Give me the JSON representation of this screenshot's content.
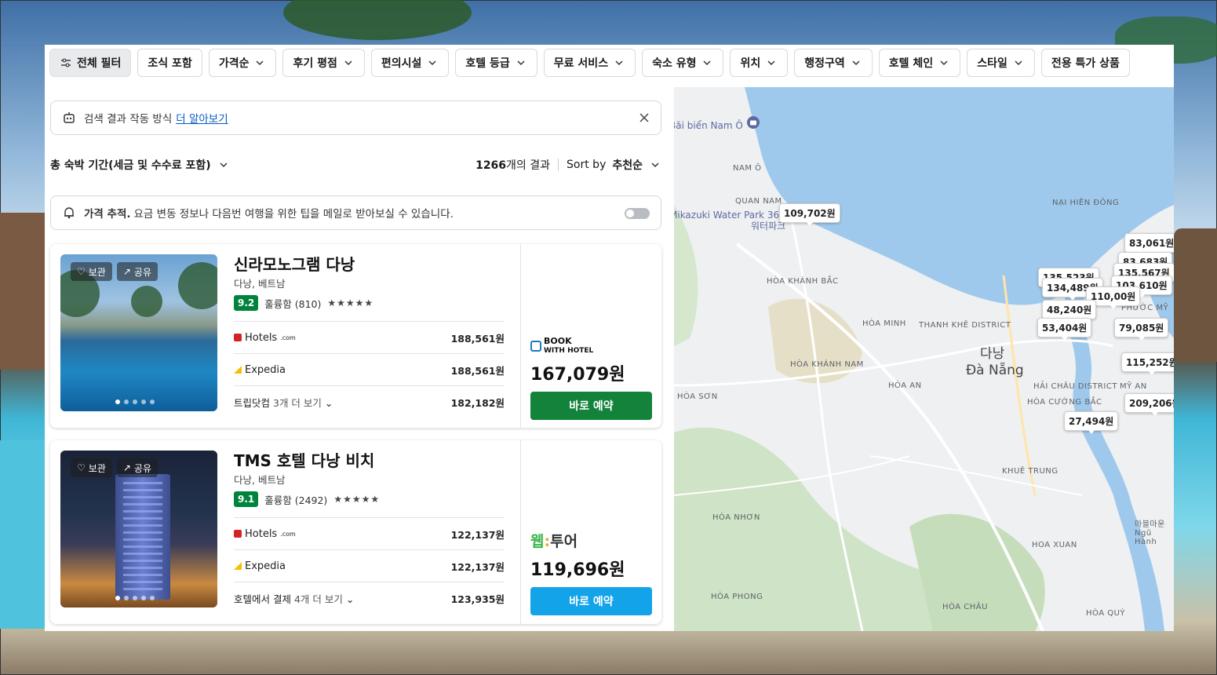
{
  "filters": [
    {
      "label": "전체 필터",
      "icon": "sliders-icon",
      "dropdown": false,
      "primary": true
    },
    {
      "label": "조식 포함",
      "dropdown": false
    },
    {
      "label": "가격순",
      "dropdown": true
    },
    {
      "label": "후기 평점",
      "dropdown": true
    },
    {
      "label": "편의시설",
      "dropdown": true
    },
    {
      "label": "호텔 등급",
      "dropdown": true
    },
    {
      "label": "무료 서비스",
      "dropdown": true
    },
    {
      "label": "숙소 유형",
      "dropdown": true
    },
    {
      "label": "위치",
      "dropdown": true
    },
    {
      "label": "행정구역",
      "dropdown": true
    },
    {
      "label": "호텔 체인",
      "dropdown": true
    },
    {
      "label": "스타일",
      "dropdown": true
    },
    {
      "label": "전용 특가 상품",
      "dropdown": false
    }
  ],
  "info_banner": {
    "text": "검색 결과 작동 방식",
    "link": "더 알아보기"
  },
  "summary": {
    "price_mode": "총 숙박 기간(세금 및 수수료 포함)",
    "count": "1266",
    "count_suffix": "개의 결과",
    "sort_label": "Sort by",
    "sort_value": "추천순"
  },
  "price_alert": {
    "bold": "가격 추적.",
    "text": "요금 변동 정보나 다음번 여행을 위한 팁을 메일로 받아보실 수 있습니다."
  },
  "photo_buttons": {
    "save": "보관",
    "share": "공유"
  },
  "hotels": [
    {
      "name": "신라모노그램 다낭",
      "location": "다낭, 베트남",
      "score": "9.2",
      "rating_text": "훌륭함 (810)",
      "stars": "★★★★★",
      "providers": [
        {
          "name": "Hotels",
          "suffix": ".com",
          "price": "188,561원"
        },
        {
          "name": "Expedia",
          "price": "188,561원"
        }
      ],
      "more": {
        "site": "트립닷컴",
        "text": "3개 더 보기",
        "price": "182,182원"
      },
      "deal": {
        "logo_line1": "BOOK",
        "logo_line2": "WITH HOTEL",
        "price": "167,079원",
        "button": "바로 예약",
        "button_color": "#13823b"
      }
    },
    {
      "name": "TMS 호텔 다낭 비치",
      "location": "다낭, 베트남",
      "score": "9.1",
      "rating_text": "훌륭함 (2492)",
      "stars": "★★★★★",
      "providers": [
        {
          "name": "Hotels",
          "suffix": ".com",
          "price": "122,137원"
        },
        {
          "name": "Expedia",
          "price": "122,137원"
        }
      ],
      "more": {
        "site": "호텔에서 결제",
        "text": "4개 더 보기",
        "price": "123,935원"
      },
      "deal": {
        "logo_a": "웹",
        "logo_b": "투어",
        "price": "119,696원",
        "button": "바로 예약",
        "button_color": "#13a3e8"
      }
    }
  ],
  "map": {
    "labels": [
      "Bãi biển Nam Ô",
      "NAM Ô",
      "QUAN NAM",
      "Mikazuki Water Park 365",
      "워터파크",
      "NẠI HIÊN ĐÔNG",
      "HÒA KHÁNH BẮC",
      "HÒA MINH",
      "THANH KHÊ DISTRICT",
      "다낭",
      "Đà Nẵng",
      "HÒA KHÁNH NAM",
      "HÒA AN",
      "HÒA SƠN",
      "HẢI CHÂU DISTRICT",
      "HÒA CƯỜNG BẮC",
      "PHƯỚC MỸ",
      "MỸ AN",
      "KHUÊ TRUNG",
      "HÒA NHƠN",
      "HOA XUAN",
      "HÒA PHONG",
      "HÒA CHÂU",
      "HÒA QUÝ",
      "마블마운",
      "Ngũ Hành"
    ],
    "price_pins": [
      "109,702원",
      "83,061원",
      "83,683원",
      "135,567원",
      "103,610원",
      "135,523원",
      "134,489원",
      "110,00원",
      "48,240원",
      "53,404원",
      "79,085원",
      "115,252원",
      "209,206원",
      "27,494원"
    ]
  },
  "colors": {
    "green_book": "#13823b",
    "blue_book": "#13a3e8",
    "score_green": "#00843d",
    "link_blue": "#0a5cc2"
  }
}
